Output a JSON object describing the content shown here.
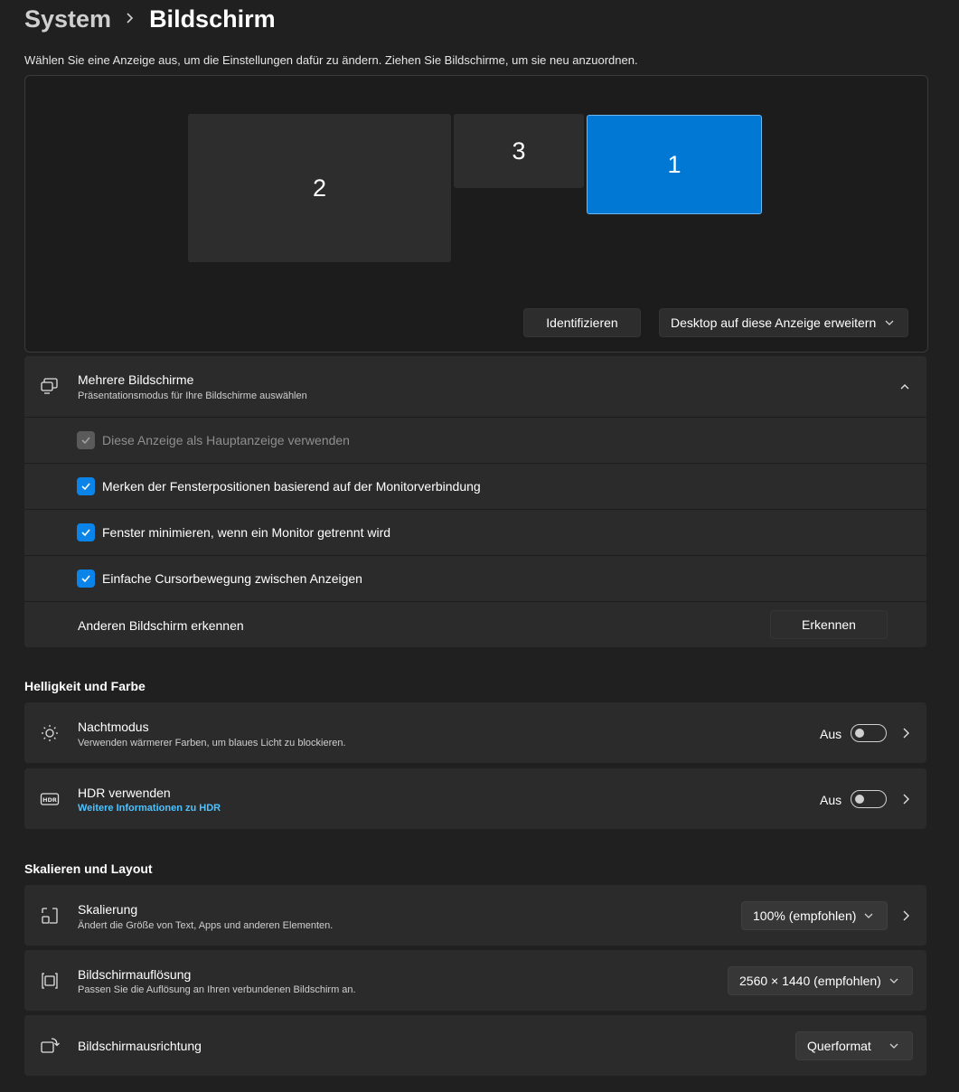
{
  "breadcrumb": {
    "parent": "System",
    "current": "Bildschirm"
  },
  "hint": "Wählen Sie eine Anzeige aus, um die Einstellungen dafür zu ändern. Ziehen Sie Bildschirme, um sie neu anzuordnen.",
  "arrangement": {
    "monitors": [
      {
        "label": "2",
        "selected": false
      },
      {
        "label": "3",
        "selected": false
      },
      {
        "label": "1",
        "selected": true
      }
    ],
    "identify_label": "Identifizieren",
    "extend_label": "Desktop auf diese Anzeige erweitern"
  },
  "multiple_displays": {
    "title": "Mehrere Bildschirme",
    "subtitle": "Präsentationsmodus für Ihre Bildschirme auswählen",
    "expanded": true,
    "options": [
      {
        "label": "Diese Anzeige als Hauptanzeige verwenden",
        "checked": true,
        "enabled": false
      },
      {
        "label": "Merken der Fensterpositionen basierend auf der Monitorverbindung",
        "checked": true,
        "enabled": true
      },
      {
        "label": "Fenster minimieren, wenn ein Monitor getrennt wird",
        "checked": true,
        "enabled": true
      },
      {
        "label": "Einfache Cursorbewegung zwischen Anzeigen",
        "checked": true,
        "enabled": true
      }
    ],
    "detect": {
      "label": "Anderen Bildschirm erkennen",
      "button": "Erkennen"
    }
  },
  "brightness_section": {
    "title": "Helligkeit und Farbe",
    "night_mode": {
      "title": "Nachtmodus",
      "subtitle": "Verwenden wärmerer Farben, um blaues Licht zu blockieren.",
      "state": "Aus",
      "on": false
    },
    "hdr": {
      "title": "HDR verwenden",
      "link": "Weitere Informationen zu HDR",
      "state": "Aus",
      "on": false
    }
  },
  "layout_section": {
    "title": "Skalieren und Layout",
    "scale": {
      "title": "Skalierung",
      "subtitle": "Ändert die Größe von Text, Apps und anderen Elementen.",
      "value": "100% (empfohlen)"
    },
    "resolution": {
      "title": "Bildschirmauflösung",
      "subtitle": "Passen Sie die Auflösung an Ihren verbundenen Bildschirm an.",
      "value": "2560 × 1440 (empfohlen)"
    },
    "orientation": {
      "title": "Bildschirmausrichtung",
      "value": "Querformat"
    }
  },
  "colors": {
    "accent": "#0078d4",
    "card": "#2b2b2b",
    "background": "#202020",
    "link": "#4cc2ff"
  }
}
